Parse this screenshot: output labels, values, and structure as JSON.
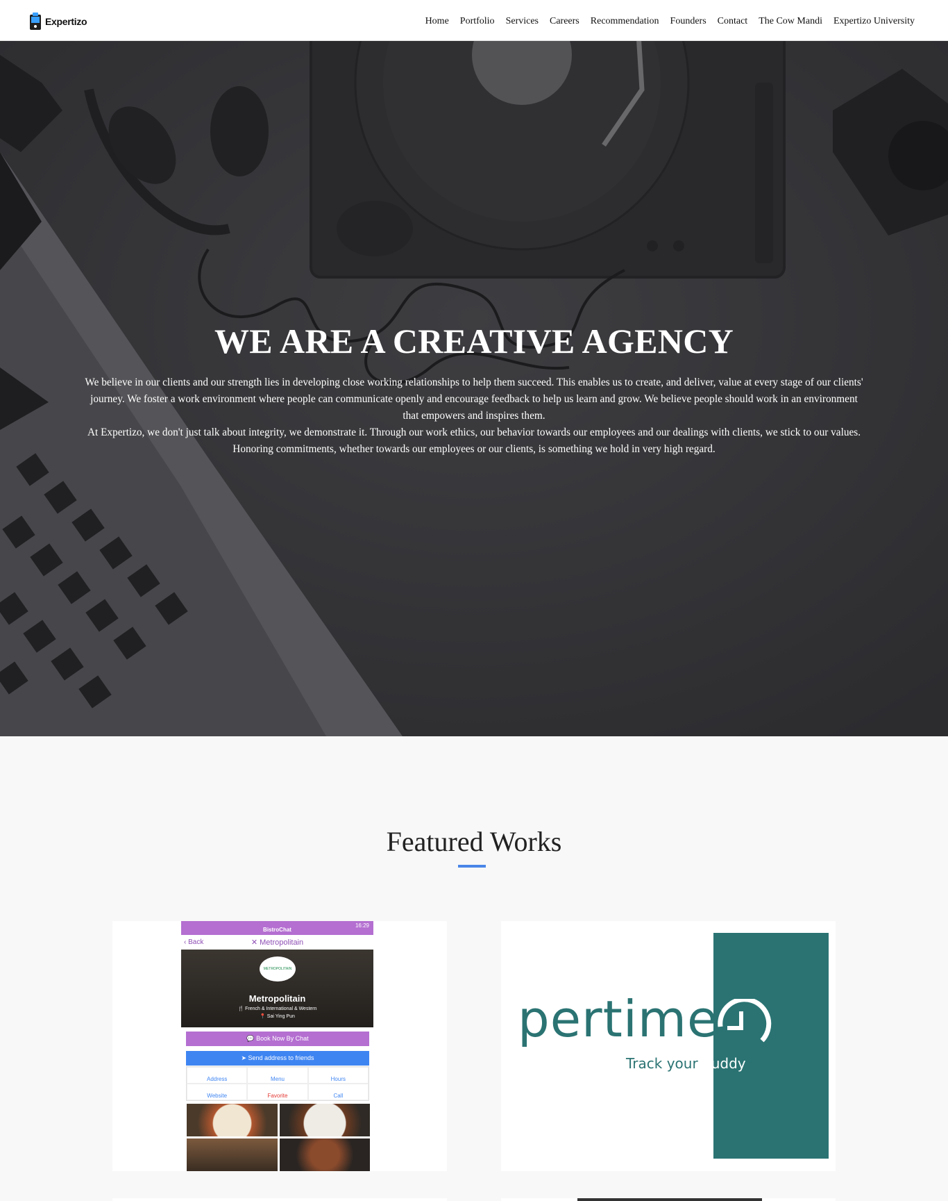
{
  "brand": {
    "name": "Expertizo"
  },
  "nav": {
    "items": [
      {
        "label": "Home"
      },
      {
        "label": "Portfolio"
      },
      {
        "label": "Services"
      },
      {
        "label": "Careers"
      },
      {
        "label": "Recommendation"
      },
      {
        "label": "Founders"
      },
      {
        "label": "Contact"
      },
      {
        "label": "The Cow Mandi"
      },
      {
        "label": "Expertizo University"
      }
    ]
  },
  "hero": {
    "title": "WE ARE A CREATIVE AGENCY",
    "paragraph1": "We believe in our clients and our strength lies in developing close working relationships to help them succeed. This enables us to create, and deliver, value at every stage of our clients' journey. We foster a work environment where people can communicate openly and encourage feedback to help us learn and grow. We believe people should work in an environment that empowers and inspires them.",
    "paragraph2": "At Expertizo, we don't just talk about integrity, we demonstrate it. Through our work ethics, our behavior towards our employees and our dealings with clients, we stick to our values. Honoring commitments, whether towards our employees or our clients, is something we hold in very high regard."
  },
  "featured": {
    "title": "Featured Works",
    "accent_color": "#4a86e8",
    "works": [
      {
        "app_name": "BistroChat",
        "status_time": "16:29",
        "back_label": "Back",
        "screen_title": "Metropolitain",
        "logo_text": "METROPOLITAIN",
        "restaurant_name": "Metropolitain",
        "cuisine": "French & International & Western",
        "location": "Sai Ying Pun",
        "book_button": "Book Now By Chat",
        "send_button": "Send address to friends",
        "actions": [
          {
            "label": "Address",
            "icon": "map-pin-icon"
          },
          {
            "label": "Menu",
            "icon": "fork-knife-icon"
          },
          {
            "label": "Hours",
            "icon": "clock-icon"
          },
          {
            "label": "Website",
            "icon": "globe-icon"
          },
          {
            "label": "Favorite",
            "icon": "heart-icon"
          },
          {
            "label": "Call",
            "icon": "phone-icon"
          }
        ]
      },
      {
        "logo_word": "pertime",
        "tagline_part1": "Track your",
        "tagline_part2": " buddy",
        "brand_color": "#2b7373"
      }
    ]
  }
}
